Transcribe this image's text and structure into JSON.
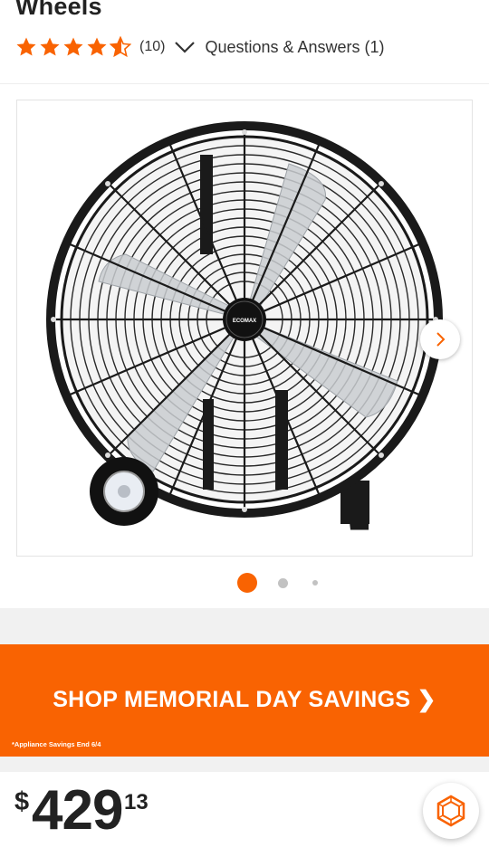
{
  "product": {
    "title": "Wheels",
    "rating": 4.5,
    "review_count": "(10)",
    "qa_link": "Questions & Answers (1)",
    "image_logo": "ECOMAX"
  },
  "gallery": {
    "image_count": 3,
    "active_index": 0
  },
  "promo": {
    "headline": "SHOP MEMORIAL DAY SAVINGS ❯",
    "fine_print": "*Appliance Savings End 6/4"
  },
  "price": {
    "currency": "$",
    "dollars": "429",
    "cents": "13"
  },
  "colors": {
    "accent": "#f96302",
    "star": "#f96302",
    "text": "#333333"
  },
  "icons": {
    "dropdown": "chevron-down-icon",
    "next": "chevron-right-icon",
    "chat": "chat-icon"
  }
}
